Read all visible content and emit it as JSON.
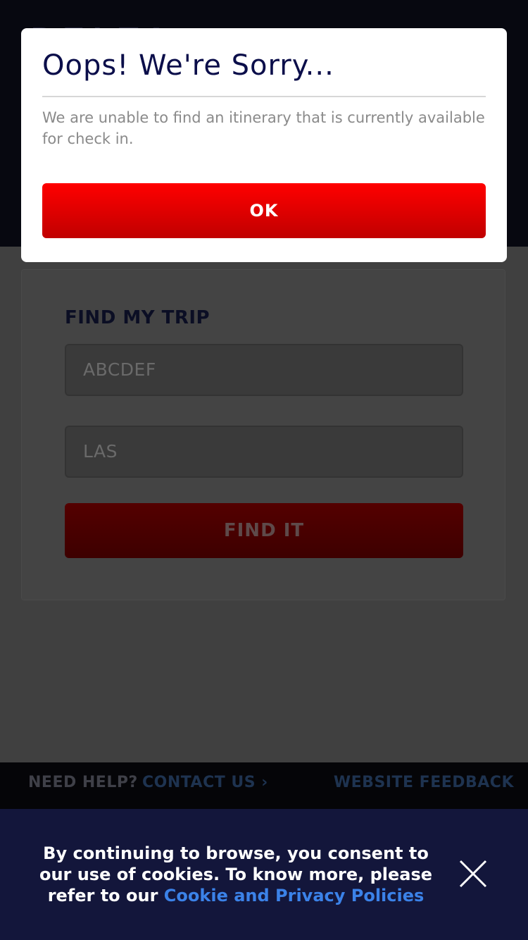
{
  "modal": {
    "title": "Oops! We're Sorry...",
    "message": "We are unable to find an itinerary that is currently available for check in.",
    "ok_label": "OK"
  },
  "find_trip": {
    "title": "FIND MY TRIP",
    "confirmation_value": "ABCDEF",
    "airport_value": "LAS",
    "find_label": "FIND IT"
  },
  "footer": {
    "need_help": "NEED HELP?",
    "contact_us": "CONTACT US",
    "contact_chevron": "›",
    "feedback": "WEBSITE FEEDBACK"
  },
  "cookie_banner": {
    "text_prefix": "By continuing to browse, you consent to our use of cookies. To know more, please refer to our ",
    "link_label": "Cookie and Privacy Policies",
    "close_icon": "close-icon"
  },
  "colors": {
    "ok_button": "#ff0000",
    "link": "#3b82e8",
    "cookie_bg": "#13163b",
    "title": "#0b0e4a"
  }
}
